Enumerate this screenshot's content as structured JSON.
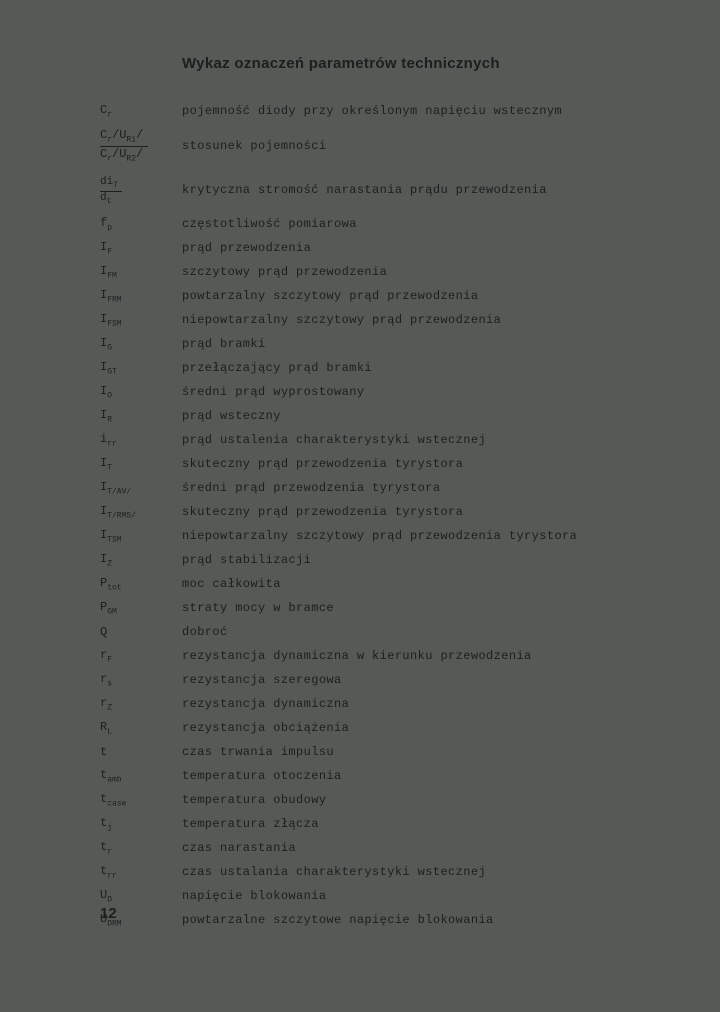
{
  "title": "Wykaz oznaczeń parametrów technicznych",
  "entries": [
    {
      "symbol_html": "C<sub>r</sub>",
      "plain": false,
      "desc": "pojemność diody przy określonym napięciu wstecznym"
    },
    {
      "type": "ratio",
      "num": "C<sub>r</sub>/U<sub>R1</sub>/",
      "den": "C<sub>r</sub>/U<sub>R2</sub>/",
      "desc": "stosunek pojemności"
    },
    {
      "type": "ratio_small",
      "num": "di<sub>T</sub>",
      "den": "d<sub>t</sub>",
      "desc": "krytyczna stromość narastania prądu przewodzenia"
    },
    {
      "symbol_html": "f<sub>p</sub>",
      "desc": "częstotliwość pomiarowa"
    },
    {
      "symbol_html": "I<sub>F</sub>",
      "desc": "prąd przewodzenia"
    },
    {
      "symbol_html": "I<sub>FM</sub>",
      "desc": "szczytowy prąd przewodzenia"
    },
    {
      "symbol_html": "I<sub>FRM</sub>",
      "desc": "powtarzalny szczytowy prąd przewodzenia"
    },
    {
      "symbol_html": "I<sub>FSM</sub>",
      "desc": "niepowtarzalny szczytowy prąd przewodzenia"
    },
    {
      "symbol_html": "I<sub>G</sub>",
      "desc": "prąd bramki"
    },
    {
      "symbol_html": "I<sub>GT</sub>",
      "desc": "przełączający prąd bramki"
    },
    {
      "symbol_html": "I<sub>O</sub>",
      "desc": "średni prąd wyprostowany"
    },
    {
      "symbol_html": "I<sub>R</sub>",
      "desc": "prąd wsteczny"
    },
    {
      "symbol_html": "i<sub>rr</sub>",
      "desc": "prąd ustalenia charakterystyki wstecznej"
    },
    {
      "symbol_html": "I<sub>T</sub>",
      "desc": "skuteczny prąd przewodzenia tyrystora"
    },
    {
      "symbol_html": "I<sub>T/AV/</sub>",
      "desc": "średni prąd przewodzenia tyrystora"
    },
    {
      "symbol_html": "I<sub>T/RMS/</sub>",
      "desc": "skuteczny prąd przewodzenia tyrystora"
    },
    {
      "symbol_html": "I<sub>TSM</sub>",
      "desc": "niepowtarzalny szczytowy prąd przewodzenia tyrystora"
    },
    {
      "symbol_html": "I<sub>Z</sub>",
      "desc": "prąd stabilizacji"
    },
    {
      "symbol_html": "P<sub>tot</sub>",
      "desc": "moc całkowita"
    },
    {
      "symbol_html": "P<sub>GM</sub>",
      "desc": "straty mocy w bramce"
    },
    {
      "symbol_html": "Q",
      "desc": "dobroć"
    },
    {
      "symbol_html": "r<sub>F</sub>",
      "desc": "rezystancja dynamiczna w kierunku przewodzenia"
    },
    {
      "symbol_html": "r<sub>s</sub>",
      "desc": "rezystancja szeregowa"
    },
    {
      "symbol_html": "r<sub>Z</sub>",
      "desc": "rezystancja dynamiczna"
    },
    {
      "symbol_html": "R<sub>L</sub>",
      "desc": "rezystancja obciążenia"
    },
    {
      "symbol_html": "t",
      "desc": "czas trwania impulsu"
    },
    {
      "symbol_html": "t<sub>amb</sub>",
      "desc": "temperatura otoczenia"
    },
    {
      "symbol_html": "t<sub>case</sub>",
      "desc": "temperatura obudowy"
    },
    {
      "symbol_html": "t<sub>j</sub>",
      "desc": "temperatura złącza"
    },
    {
      "symbol_html": "t<sub>r</sub>",
      "desc": "czas narastania"
    },
    {
      "symbol_html": "t<sub>rr</sub>",
      "desc": "czas ustalania charakterystyki wstecznej"
    },
    {
      "symbol_html": "U<sub>D</sub>",
      "desc": "napięcie blokowania"
    },
    {
      "symbol_html": "U<sub>DRM</sub>",
      "desc": "powtarzalne szczytowe napięcie blokowania"
    }
  ],
  "page_number": "12"
}
